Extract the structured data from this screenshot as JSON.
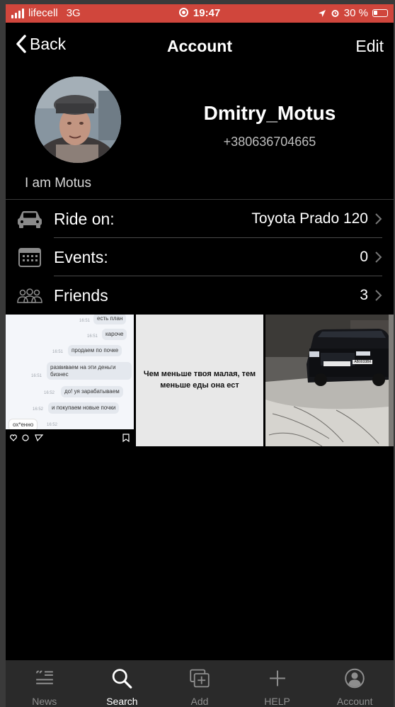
{
  "status_bar": {
    "carrier": "lifecell",
    "network": "3G",
    "time": "19:47",
    "battery": "30 %",
    "bg_color": "#d0463c"
  },
  "navbar": {
    "back_label": "Back",
    "title": "Account",
    "edit_label": "Edit"
  },
  "profile": {
    "username": "Dmitry_Motus",
    "phone": "+380636704665",
    "status": "I am Motus"
  },
  "rows": [
    {
      "label": "Ride on:",
      "value": "Toyota Prado 120",
      "icon": "car-icon"
    },
    {
      "label": "Events:",
      "value": "0",
      "icon": "calendar-icon"
    },
    {
      "label": "Friends",
      "value": "3",
      "icon": "friends-icon"
    }
  ],
  "grid": {
    "chat": [
      {
        "text": "есть план",
        "time": "16:51"
      },
      {
        "text": "кароче",
        "time": "16:51"
      },
      {
        "text": "продаем по почке",
        "time": "16:51"
      },
      {
        "text": "развиваем на эти деньги бизнес",
        "time": "16:51"
      },
      {
        "text": "до! уя зарабатываем",
        "time": "16:52"
      },
      {
        "text": "и покупаем новые почки",
        "time": "16:52"
      },
      {
        "text": "ох*енно",
        "time": "16:52"
      }
    ],
    "quote": "Чем меньше твоя малая, тем меньше еды она ест",
    "plate": "АВ0033ВК"
  },
  "tabs": [
    {
      "label": "News",
      "icon": "news-icon",
      "active": false
    },
    {
      "label": "Search",
      "icon": "search-icon",
      "active": true
    },
    {
      "label": "Add",
      "icon": "add-icon",
      "active": false
    },
    {
      "label": "HELP",
      "icon": "plus-icon",
      "active": false
    },
    {
      "label": "Account",
      "icon": "account-icon",
      "active": false
    }
  ]
}
